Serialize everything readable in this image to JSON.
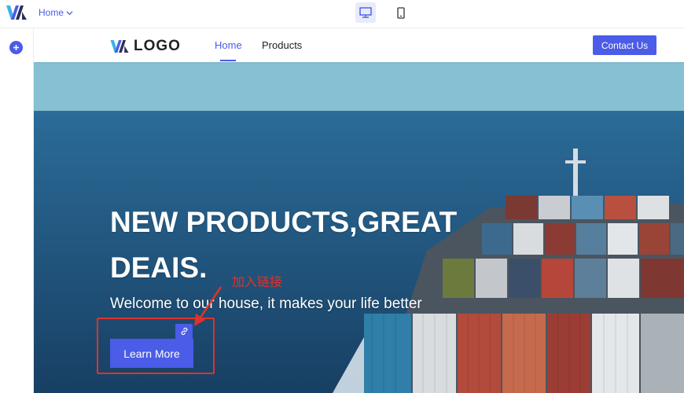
{
  "editor": {
    "page_selector": "Home",
    "devices": [
      "desktop-icon",
      "mobile-icon"
    ]
  },
  "site": {
    "logo_text": "LOGO",
    "nav": [
      "Home",
      "Products"
    ],
    "contact_label": "Contact Us"
  },
  "hero": {
    "title": "NEW PRODUCTS,GREAT DEAIS.",
    "subtitle": "Welcome to our house, it makes your life better",
    "button_label": "Learn More",
    "annotation": "加入链接"
  },
  "colors": {
    "accent": "#4a5ce8",
    "annotation": "#e0322a"
  }
}
